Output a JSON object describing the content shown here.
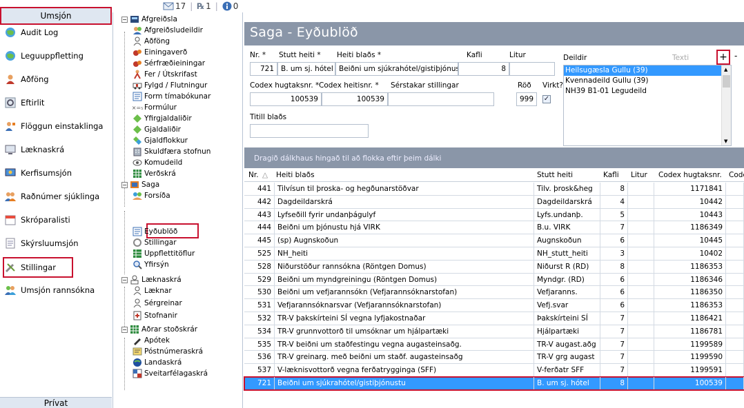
{
  "counters": {
    "mail": "17",
    "rx": "1",
    "info": "0"
  },
  "leftnav": {
    "top_button": "Umsjón",
    "items": [
      {
        "label": "Audit Log",
        "icon": "globe-icon"
      },
      {
        "label": "Leguuppfletting",
        "icon": "globe-icon"
      },
      {
        "label": "Aðföng",
        "icon": "person-icon"
      },
      {
        "label": "Eftirlit",
        "icon": "gear-icon"
      },
      {
        "label": "Flöggun einstaklinga",
        "icon": "person-flag-icon"
      },
      {
        "label": "Læknaskrá",
        "icon": "monitor-icon"
      },
      {
        "label": "Kerfisumsjón",
        "icon": "computer-icon"
      },
      {
        "label": "Raðnúmer sjúklinga",
        "icon": "people-icon"
      },
      {
        "label": "Skróparalisti",
        "icon": "calendar-icon"
      },
      {
        "label": "Skýrsluumsjón",
        "icon": "document-icon"
      },
      {
        "label": "Stillingar",
        "icon": "tools-icon"
      },
      {
        "label": "Umsjón rannsókna",
        "icon": "people-icon"
      }
    ],
    "bottom_button": "Prívat"
  },
  "tree": {
    "groups": [
      {
        "label": "Afgreiðsla",
        "children": [
          "Afgreiðsludeildir",
          "Aðföng",
          "Einingaverð",
          "Sérfræðieiningar",
          "Fer / Útskrifast",
          "Fylgd / Flutningur",
          "Form tímabókunar",
          "Formúlur",
          "Yfirgjaldaliðir",
          "Gjaldaliðir",
          "Gjaldflokkur",
          "Skuldfæra stofnun",
          "Komudeild",
          "Verðskrá"
        ]
      },
      {
        "label": "Saga",
        "children": [
          "Forsíða",
          "Eyðublöð",
          "Stillingar",
          "Uppflettitöflur",
          "Yfirsýn"
        ]
      },
      {
        "label": "Læknaskrá",
        "children": [
          "Læknar",
          "Sérgreinar",
          "Stofnanir"
        ]
      },
      {
        "label": "Aðrar stoðskrár",
        "children": [
          "Apótek",
          "Póstnúmeraskrá",
          "Landaskrá",
          "Sveitarfélagaskrá"
        ]
      }
    ]
  },
  "main": {
    "title": "Saga - Eyðublöð",
    "form": {
      "nr_label": "Nr. *",
      "nr_value": "721",
      "stutt_label": "Stutt heiti *",
      "stutt_value": "B. um sj. hótel",
      "heiti_label": "Heiti blaðs *",
      "heiti_value": "Beiðni um sjúkrahótel/gistiþjónus",
      "kafli_label": "Kafli",
      "kafli_value": "8",
      "litur_label": "Litur",
      "litur_value": "",
      "deildir_label": "Deildir",
      "texti_label": "Texti",
      "codex_hug_label": "Codex hugtaksnr. *",
      "codex_hug_value": "100539",
      "codex_heit_label": "Codex heitisnr. *",
      "codex_heit_value": "100539",
      "serstakar_label": "Sérstakar stillingar",
      "serstakar_value": "",
      "rod_label": "Röð",
      "rod_value": "999",
      "virkt_label": "Virkt?",
      "virkt_checked": "✓",
      "titill_label": "Titill blaðs",
      "titill_value": "",
      "deildir": [
        "Heilsugæsla Gullu (39)",
        "Kvennadeild Gullu (39)",
        "NH39 B1-01 Legudeild"
      ],
      "plus": "+",
      "minus": "-"
    },
    "group_hint": "Dragið dálkhaus hingað til að flokka eftir þeim dálki",
    "grid": {
      "columns": [
        "Nr.",
        "Heiti blaðs",
        "Stutt heiti",
        "Kafli",
        "Litur",
        "Codex hugtaksnr.",
        "Code"
      ],
      "sort_mark": "△",
      "rows": [
        [
          "441",
          "Tilvísun til þroska- og hegðunarstöðvar",
          "Tilv. þrosk&heg",
          "8",
          "",
          "1171841"
        ],
        [
          "442",
          "Dagdeildarskrá",
          "Dagdeildarskrá",
          "4",
          "",
          "10442"
        ],
        [
          "443",
          "Lyfseðill fyrir undanþágulyf",
          "Lyfs.undanþ.",
          "5",
          "",
          "10443"
        ],
        [
          "444",
          "Beiðni um þjónustu hjá VIRK",
          "B.u. VIRK",
          "7",
          "",
          "1186349"
        ],
        [
          "445",
          "(sp) Augnskoðun",
          "Augnskoðun",
          "6",
          "",
          "10445"
        ],
        [
          "525",
          "NH_heiti",
          "NH_stutt_heiti",
          "3",
          "",
          "10402"
        ],
        [
          "528",
          "Niðurstöður rannsókna (Röntgen Domus)",
          "Niðurst R (RD)",
          "8",
          "",
          "1186353"
        ],
        [
          "529",
          "Beiðni um myndgreiningu (Röntgen Domus)",
          "Myndgr. (RD)",
          "6",
          "",
          "1186346"
        ],
        [
          "530",
          "Beiðni um vefjarannsókn (Vefjarannsóknarstofan)",
          "Vefjaranns.",
          "6",
          "",
          "1186350"
        ],
        [
          "531",
          "Vefjarannsóknarsvar (Vefjarannsóknarstofan)",
          "Vefj.svar",
          "6",
          "",
          "1186353"
        ],
        [
          "532",
          "TR-V þakskírteini SÍ vegna lyfjakostnaðar",
          "Þakskírteini SÍ",
          "7",
          "",
          "1186421"
        ],
        [
          "534",
          "TR-V grunnvottorð til umsóknar um hjálpartæki",
          "Hjálpartæki",
          "7",
          "",
          "1186781"
        ],
        [
          "535",
          "TR-V beiðni um staðfestingu vegna augasteinsaðg.",
          "TR-V augast.aðg",
          "7",
          "",
          "1199589"
        ],
        [
          "536",
          "TR-V greinarg. með beiðni um staðf. augasteinsaðg",
          "TR-V grg augast",
          "7",
          "",
          "1199590"
        ],
        [
          "537",
          "V-læknisvottorð vegna ferðatrygginga (SFF)",
          "V-ferðatr SFF",
          "7",
          "",
          "1199591"
        ],
        [
          "721",
          "Beiðni um sjúkrahótel/gistiþjónustu",
          "B. um sj. hótel",
          "8",
          "",
          "100539"
        ]
      ],
      "selected_row": 15
    }
  }
}
